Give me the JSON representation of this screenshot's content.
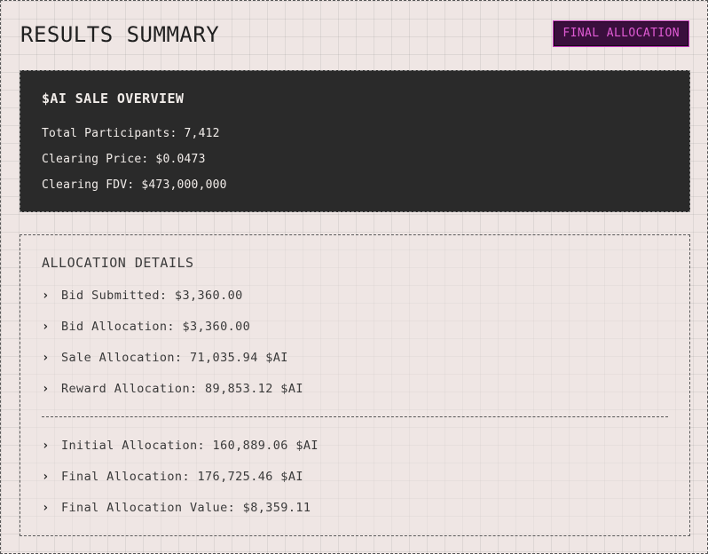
{
  "header": {
    "title": "RESULTS SUMMARY",
    "badge": "FINAL ALLOCATION"
  },
  "overview": {
    "title": "$AI SALE OVERVIEW",
    "rows": [
      "Total Participants: 7,412",
      "Clearing Price: $0.0473",
      "Clearing FDV: $473,000,000"
    ]
  },
  "details": {
    "title": "ALLOCATION DETAILS",
    "icon": "chevron-right-icon",
    "group1": [
      "Bid Submitted: $3,360.00",
      "Bid Allocation: $3,360.00",
      "Sale Allocation: 71,035.94 $AI",
      "Reward Allocation: 89,853.12 $AI"
    ],
    "group2": [
      "Initial Allocation: 160,889.06 $AI",
      "Final Allocation: 176,725.46 $AI",
      "Final Allocation Value: $8,359.11"
    ]
  },
  "colors": {
    "background": "#efe6e4",
    "panel_dark": "#2a2a2a",
    "badge_bg": "#3a0f3d",
    "badge_text": "#e05bd4",
    "badge_border": "#c43bbd"
  }
}
